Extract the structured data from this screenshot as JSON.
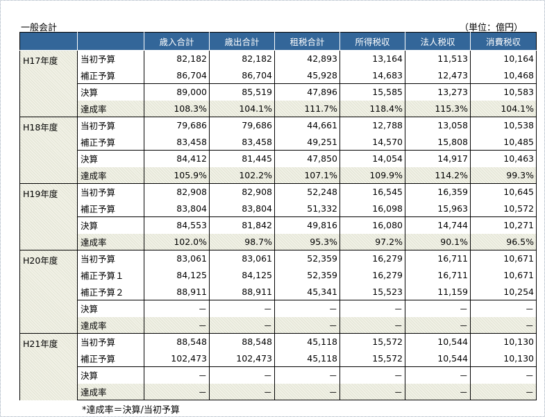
{
  "title": "一般会計",
  "unit": "（単位：億円）",
  "columns": [
    "歳入合計",
    "歳出合計",
    "租税合計",
    "所得税収",
    "法人税収",
    "消費税収"
  ],
  "groups": [
    {
      "year": "H17年度",
      "rows": [
        {
          "label": "当初予算",
          "values": [
            "82,182",
            "82,182",
            "42,893",
            "13,164",
            "11,513",
            "10,164"
          ]
        },
        {
          "label": "補正予算",
          "values": [
            "86,704",
            "86,704",
            "45,928",
            "14,683",
            "12,473",
            "10,468"
          ]
        },
        {
          "label": "決算",
          "sep": true,
          "values": [
            "89,000",
            "85,519",
            "47,896",
            "15,585",
            "13,273",
            "10,583"
          ]
        },
        {
          "label": "達成率",
          "rate": true,
          "values": [
            "108.3%",
            "104.1%",
            "111.7%",
            "118.4%",
            "115.3%",
            "104.1%"
          ]
        }
      ]
    },
    {
      "year": "H18年度",
      "rows": [
        {
          "label": "当初予算",
          "values": [
            "79,686",
            "79,686",
            "44,661",
            "12,788",
            "13,058",
            "10,538"
          ]
        },
        {
          "label": "補正予算",
          "values": [
            "83,458",
            "83,458",
            "49,251",
            "14,570",
            "15,808",
            "10,485"
          ]
        },
        {
          "label": "決算",
          "sep": true,
          "values": [
            "84,412",
            "81,445",
            "47,850",
            "14,054",
            "14,917",
            "10,463"
          ]
        },
        {
          "label": "達成率",
          "rate": true,
          "values": [
            "105.9%",
            "102.2%",
            "107.1%",
            "109.9%",
            "114.2%",
            "99.3%"
          ]
        }
      ]
    },
    {
      "year": "H19年度",
      "rows": [
        {
          "label": "当初予算",
          "values": [
            "82,908",
            "82,908",
            "52,248",
            "16,545",
            "16,359",
            "10,645"
          ]
        },
        {
          "label": "補正予算",
          "values": [
            "83,804",
            "83,804",
            "51,332",
            "16,098",
            "15,963",
            "10,572"
          ]
        },
        {
          "label": "決算",
          "sep": true,
          "values": [
            "84,553",
            "81,842",
            "49,816",
            "16,080",
            "14,744",
            "10,271"
          ]
        },
        {
          "label": "達成率",
          "rate": true,
          "values": [
            "102.0%",
            "98.7%",
            "95.3%",
            "97.2%",
            "90.1%",
            "96.5%"
          ]
        }
      ]
    },
    {
      "year": "H20年度",
      "rows": [
        {
          "label": "当初予算",
          "values": [
            "83,061",
            "83,061",
            "52,359",
            "16,279",
            "16,711",
            "10,671"
          ]
        },
        {
          "label": "補正予算１",
          "values": [
            "84,125",
            "84,125",
            "52,359",
            "16,279",
            "16,711",
            "10,671"
          ]
        },
        {
          "label": "補正予算２",
          "values": [
            "88,911",
            "88,911",
            "45,341",
            "15,523",
            "11,159",
            "10,254"
          ]
        },
        {
          "label": "決算",
          "sep": true,
          "values": [
            "－",
            "－",
            "－",
            "－",
            "－",
            "－"
          ]
        },
        {
          "label": "達成率",
          "rate": true,
          "values": [
            "－",
            "－",
            "－",
            "－",
            "－",
            "－"
          ]
        }
      ]
    },
    {
      "year": "H21年度",
      "rows": [
        {
          "label": "当初予算",
          "values": [
            "88,548",
            "88,548",
            "45,118",
            "15,572",
            "10,544",
            "10,130"
          ]
        },
        {
          "label": "補正予算",
          "values": [
            "102,473",
            "102,473",
            "45,118",
            "15,572",
            "10,544",
            "10,130"
          ]
        },
        {
          "label": "決算",
          "sep": true,
          "values": [
            "－",
            "－",
            "－",
            "－",
            "－",
            "－"
          ]
        },
        {
          "label": "達成率",
          "rate": true,
          "values": [
            "－",
            "－",
            "－",
            "－",
            "－",
            "－"
          ]
        }
      ]
    }
  ],
  "footnote": "*達成率＝決算/当初予算"
}
